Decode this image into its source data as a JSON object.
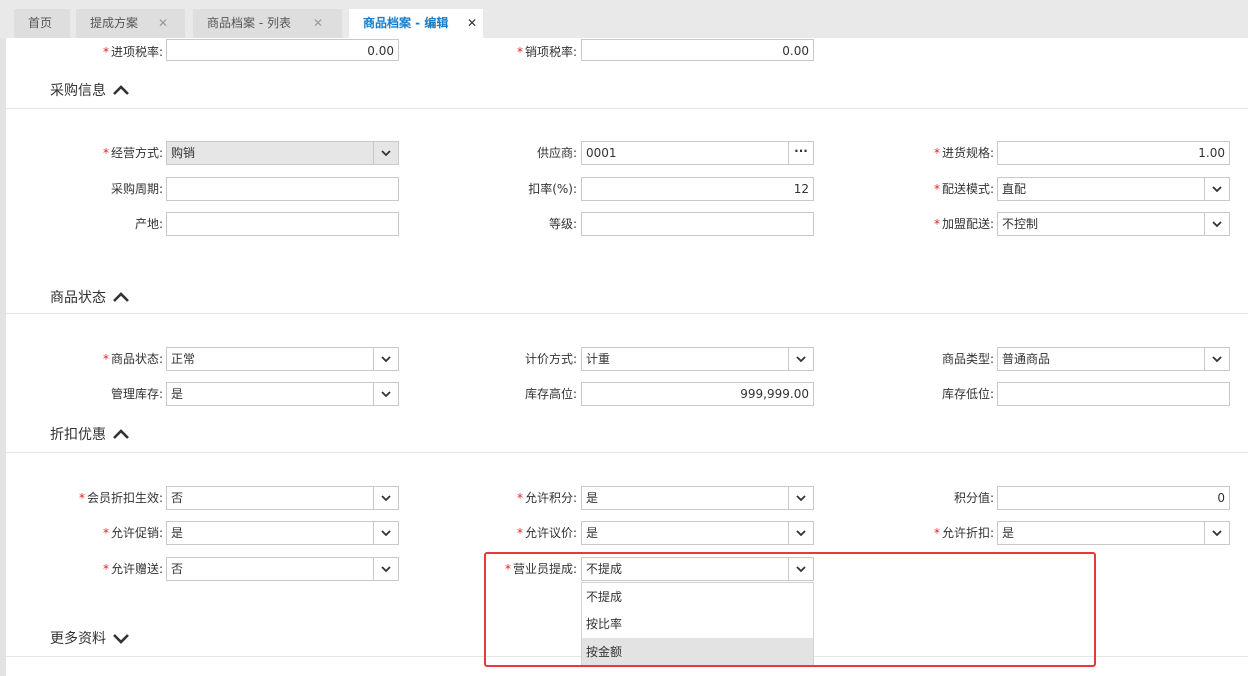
{
  "tabs": [
    {
      "label": "首页"
    },
    {
      "label": "提成方案",
      "close": "✕"
    },
    {
      "label": "商品档案 - 列表",
      "close": "✕"
    },
    {
      "label": "商品档案 - 编辑",
      "close": "✕"
    }
  ],
  "top_row": {
    "input_tax_label": "进项税率:",
    "input_tax_value": "0.00",
    "output_tax_label": "销项税率:",
    "output_tax_value": "0.00"
  },
  "sections": {
    "purchase": "采购信息",
    "status": "商品状态",
    "discount": "折扣优惠",
    "more": "更多资料"
  },
  "purchase": {
    "mode_label": "经营方式:",
    "mode_value": "购销",
    "supplier_label": "供应商:",
    "supplier_value": "0001",
    "spec_label": "进货规格:",
    "spec_value": "1.00",
    "cycle_label": "采购周期:",
    "cycle_value": "",
    "discount_label": "扣率(%):",
    "discount_value": "12",
    "delivery_label": "配送模式:",
    "delivery_value": "直配",
    "origin_label": "产地:",
    "origin_value": "",
    "grade_label": "等级:",
    "grade_value": "",
    "franchise_label": "加盟配送:",
    "franchise_value": "不控制"
  },
  "status": {
    "state_label": "商品状态:",
    "state_value": "正常",
    "pricing_label": "计价方式:",
    "pricing_value": "计重",
    "type_label": "商品类型:",
    "type_value": "普通商品",
    "stock_mgmt_label": "管理库存:",
    "stock_mgmt_value": "是",
    "stock_high_label": "库存高位:",
    "stock_high_value": "999,999.00",
    "stock_low_label": "库存低位:",
    "stock_low_value": ""
  },
  "discount": {
    "member_label": "会员折扣生效:",
    "member_value": "否",
    "points_label": "允许积分:",
    "points_value": "是",
    "points_val_label": "积分值:",
    "points_val_value": "0",
    "promo_label": "允许促销:",
    "promo_value": "是",
    "bargain_label": "允许议价:",
    "bargain_value": "是",
    "allow_discount_label": "允许折扣:",
    "allow_discount_value": "是",
    "gift_label": "允许赠送:",
    "gift_value": "否",
    "commission_label": "营业员提成:",
    "commission_value": "不提成"
  },
  "commission_options": [
    "不提成",
    "按比率",
    "按金额"
  ],
  "highlighted_option": "按金额",
  "colors": {
    "accent": "#1a7cc9",
    "required": "#e02424",
    "highlight_box": "#e8393a"
  },
  "icons": {
    "dropdown": "chevron-down-icon",
    "section_open": "chevron-up-icon",
    "section_closed": "chevron-down-icon",
    "lookup": "ellipsis-icon"
  }
}
